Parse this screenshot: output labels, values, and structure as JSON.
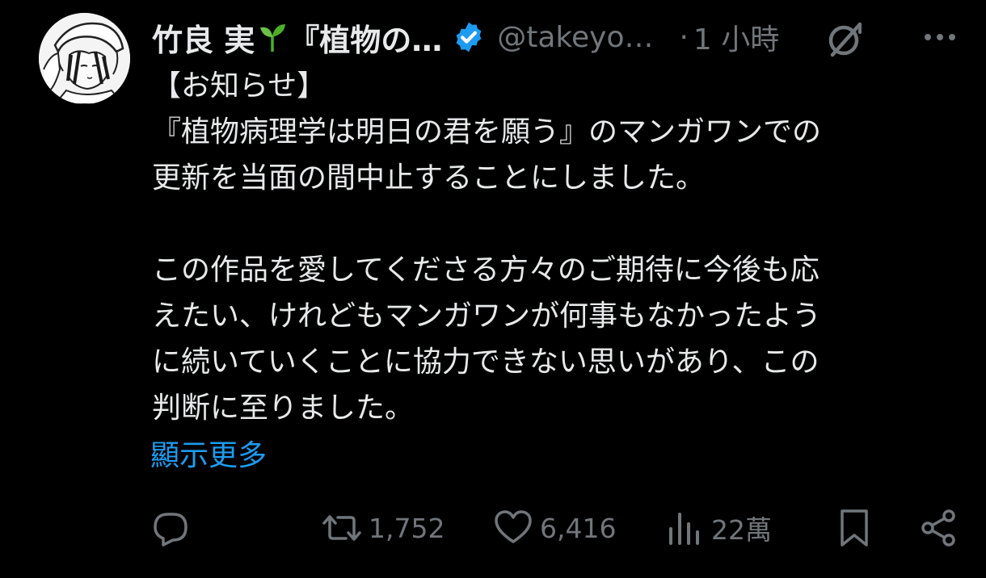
{
  "tweet": {
    "author_name": "竹良 実",
    "author_name_rest": "『植物の…",
    "handle": "@takeyo…",
    "separator": "·",
    "time": "1 小時",
    "lines": [
      "【お知らせ】",
      "『植物病理学は明日の君を願う』のマンガワンでの",
      "更新を当面の間中止することにしました。",
      "",
      "この作品を愛してくださる方々のご期待に今後も応",
      "えたい、けれどもマンガワンが何事もなかったよう",
      "に続いていくことに協力できない思いがあり、この",
      "判断に至りました。"
    ],
    "show_more": "顯示更多"
  },
  "actions": {
    "retweets": "1,752",
    "likes": "6,416",
    "views": "22萬"
  },
  "colors": {
    "background": "#000000",
    "text": "#e7e9ea",
    "muted": "#71767b",
    "link": "#1d9bf0",
    "verified": "#1d9bf0",
    "sprout": "#4caf2a"
  },
  "icons": {
    "reply": "reply-icon",
    "retweet": "retweet-icon",
    "like": "heart-icon",
    "views": "views-bar-chart-icon",
    "bookmark": "bookmark-icon",
    "share": "share-icon",
    "grok": "grok-icon",
    "more": "more-dots-icon",
    "verified": "verified-badge-icon",
    "sprout": "sprout-emoji-icon"
  }
}
